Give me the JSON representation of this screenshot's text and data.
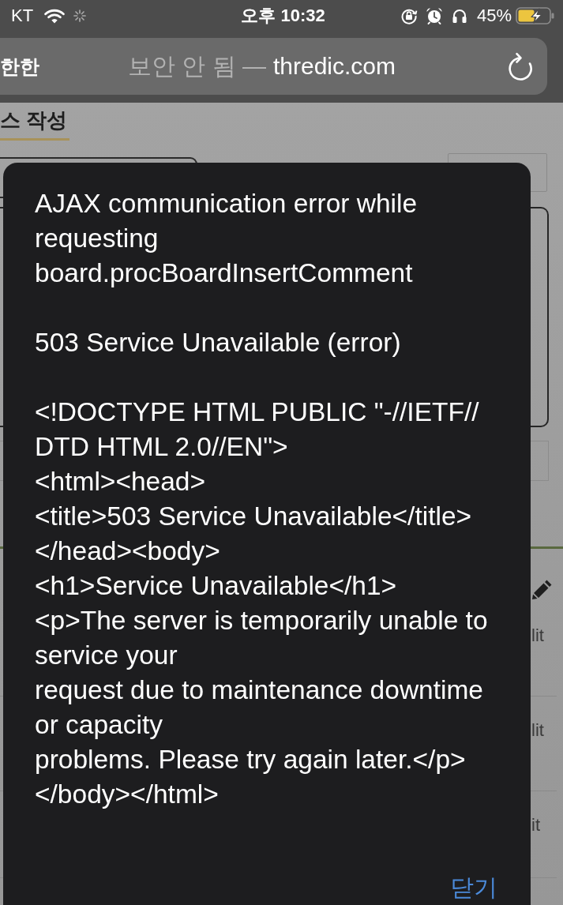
{
  "status_bar": {
    "carrier": "KT",
    "time": "오후 10:32",
    "battery": "45%"
  },
  "browser": {
    "reader_button": "한한",
    "security_label": "보안 안 됨 —",
    "domain": "thredic.com"
  },
  "page": {
    "heading": "스 작성",
    "list_rows": [
      {
        "action": "lit"
      },
      {
        "action": "lit"
      },
      {
        "action": "it"
      }
    ]
  },
  "alert": {
    "paragraphs": [
      [
        "AJAX communication error while",
        "requesting",
        "board.procBoardInsertComment"
      ],
      [
        "503 Service Unavailable (error)"
      ],
      [
        "<!DOCTYPE HTML PUBLIC \"-//IETF//",
        "DTD HTML 2.0//EN\">",
        "<html><head>",
        "<title>503 Service Unavailable</title>",
        "</head><body>",
        "<h1>Service Unavailable</h1>",
        "<p>The server is temporarily unable to",
        "service your",
        "request due to maintenance downtime",
        "or capacity",
        "problems. Please try again later.</p>",
        "</body></html>"
      ]
    ],
    "close_button": "닫기"
  }
}
